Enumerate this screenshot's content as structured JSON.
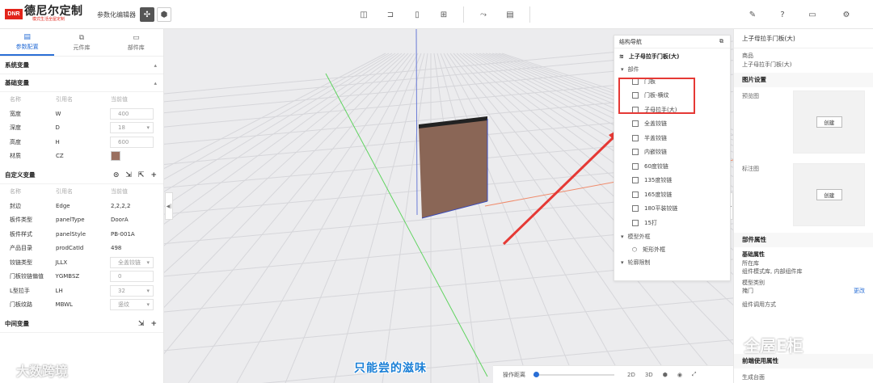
{
  "header": {
    "logo_mark": "DNR",
    "logo_text": "德尼尔定制",
    "logo_sub": "模式生活全屋定制",
    "app_name": "参数化编辑器"
  },
  "left_tabs": [
    {
      "label": "参数配置",
      "icon": "document-icon"
    },
    {
      "label": "元件库",
      "icon": "component-icon"
    },
    {
      "label": "部件库",
      "icon": "folder-icon"
    }
  ],
  "sections": {
    "system_vars": "系统变量",
    "base_vars": "基础变量",
    "custom_vars": "自定义变量",
    "middle_vars": "中间变量"
  },
  "columns": {
    "name": "名称",
    "ref": "引用名",
    "value": "当前值"
  },
  "base_rows": [
    {
      "name": "宽度",
      "ref": "W",
      "value": "400",
      "kind": "input"
    },
    {
      "name": "深度",
      "ref": "D",
      "value": "18",
      "kind": "select"
    },
    {
      "name": "高度",
      "ref": "H",
      "value": "600",
      "kind": "input"
    },
    {
      "name": "材质",
      "ref": "CZ",
      "value": "",
      "kind": "swatch"
    }
  ],
  "custom_rows": [
    {
      "name": "封边",
      "ref": "Edge",
      "value": "2,2,2,2",
      "kind": "text"
    },
    {
      "name": "板件类型",
      "ref": "panelType",
      "value": "DoorA",
      "kind": "text"
    },
    {
      "name": "板件样式",
      "ref": "panelStyle",
      "value": "PB-001A",
      "kind": "text"
    },
    {
      "name": "产品目录",
      "ref": "prodCatId",
      "value": "498",
      "kind": "text"
    },
    {
      "name": "铰链类型",
      "ref": "JLLX",
      "value": "全盖铰链",
      "kind": "select"
    },
    {
      "name": "门板铰链偏值",
      "ref": "YGMBSZ",
      "value": "0",
      "kind": "input"
    },
    {
      "name": "L型拉手",
      "ref": "LH",
      "value": "32",
      "kind": "select"
    },
    {
      "name": "门板纹路",
      "ref": "MBWL",
      "value": "竖纹",
      "kind": "select"
    }
  ],
  "nav": {
    "title": "结构导航",
    "root": "上子母拉手门板(大)",
    "group_parts": "部件",
    "parts": [
      "门板",
      "门板-横纹",
      "子母拉手(大)",
      "全盖铰链",
      "半盖铰链",
      "内嵌铰链",
      "60度铰链",
      "135度铰链",
      "165度铰链",
      "180平装铰链",
      "15打"
    ],
    "group_frame": "模型外框",
    "frame_item": "矩形外框",
    "group_limit": "轮廓限制"
  },
  "bottom_bar": {
    "label": "操作距离",
    "slider_fraction": 0.03,
    "zoom_a": "2D",
    "zoom_b": "3D"
  },
  "right": {
    "title": "上子母拉手门板(大)",
    "product_label": "商品",
    "product_value": "上子母拉手门板(大)",
    "image_settings": "图片设置",
    "preview_label": "预览图",
    "mark_label": "标注图",
    "create_label": "创建",
    "part_props": "部件属性",
    "basic_props": "基础属性",
    "library_label": "所在库",
    "library_value": "组件模式库, 内部组件库",
    "model_type_label": "模型类别",
    "model_type_value": "掩门",
    "edit_link": "更改",
    "call_mode_label": "组件调用方式",
    "frontend_props": "前端使用属性",
    "generate_label": "生成台面"
  },
  "overlay": {
    "subtitle": "只能尝的滋味",
    "watermark_left": "大数跨境",
    "watermark_right": "全屋E柜"
  },
  "colors": {
    "accent": "#2a6fd6",
    "highlight": "#e53935",
    "wood": "#8a6656"
  }
}
